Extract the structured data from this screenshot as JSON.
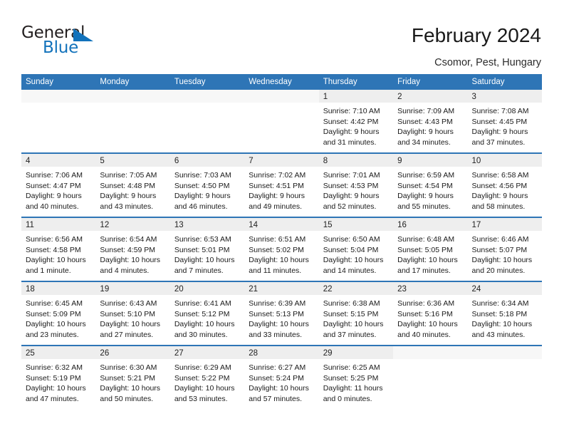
{
  "brand": {
    "word_one": "General",
    "word_two": "Blue",
    "logo_icon": "triangle-logo-icon",
    "accent_color": "#1272bb"
  },
  "header": {
    "title": "February 2024",
    "subtitle": "Csomor, Pest, Hungary"
  },
  "theme": {
    "header_blue": "#2e75b6",
    "day_band_gray": "#eeeeee",
    "text_color": "#1a1a1a"
  },
  "weekdays": [
    "Sunday",
    "Monday",
    "Tuesday",
    "Wednesday",
    "Thursday",
    "Friday",
    "Saturday"
  ],
  "weeks": [
    [
      {
        "day": "",
        "lines": []
      },
      {
        "day": "",
        "lines": []
      },
      {
        "day": "",
        "lines": []
      },
      {
        "day": "",
        "lines": []
      },
      {
        "day": "1",
        "lines": [
          "Sunrise: 7:10 AM",
          "Sunset: 4:42 PM",
          "Daylight: 9 hours",
          "and 31 minutes."
        ]
      },
      {
        "day": "2",
        "lines": [
          "Sunrise: 7:09 AM",
          "Sunset: 4:43 PM",
          "Daylight: 9 hours",
          "and 34 minutes."
        ]
      },
      {
        "day": "3",
        "lines": [
          "Sunrise: 7:08 AM",
          "Sunset: 4:45 PM",
          "Daylight: 9 hours",
          "and 37 minutes."
        ]
      }
    ],
    [
      {
        "day": "4",
        "lines": [
          "Sunrise: 7:06 AM",
          "Sunset: 4:47 PM",
          "Daylight: 9 hours",
          "and 40 minutes."
        ]
      },
      {
        "day": "5",
        "lines": [
          "Sunrise: 7:05 AM",
          "Sunset: 4:48 PM",
          "Daylight: 9 hours",
          "and 43 minutes."
        ]
      },
      {
        "day": "6",
        "lines": [
          "Sunrise: 7:03 AM",
          "Sunset: 4:50 PM",
          "Daylight: 9 hours",
          "and 46 minutes."
        ]
      },
      {
        "day": "7",
        "lines": [
          "Sunrise: 7:02 AM",
          "Sunset: 4:51 PM",
          "Daylight: 9 hours",
          "and 49 minutes."
        ]
      },
      {
        "day": "8",
        "lines": [
          "Sunrise: 7:01 AM",
          "Sunset: 4:53 PM",
          "Daylight: 9 hours",
          "and 52 minutes."
        ]
      },
      {
        "day": "9",
        "lines": [
          "Sunrise: 6:59 AM",
          "Sunset: 4:54 PM",
          "Daylight: 9 hours",
          "and 55 minutes."
        ]
      },
      {
        "day": "10",
        "lines": [
          "Sunrise: 6:58 AM",
          "Sunset: 4:56 PM",
          "Daylight: 9 hours",
          "and 58 minutes."
        ]
      }
    ],
    [
      {
        "day": "11",
        "lines": [
          "Sunrise: 6:56 AM",
          "Sunset: 4:58 PM",
          "Daylight: 10 hours",
          "and 1 minute."
        ]
      },
      {
        "day": "12",
        "lines": [
          "Sunrise: 6:54 AM",
          "Sunset: 4:59 PM",
          "Daylight: 10 hours",
          "and 4 minutes."
        ]
      },
      {
        "day": "13",
        "lines": [
          "Sunrise: 6:53 AM",
          "Sunset: 5:01 PM",
          "Daylight: 10 hours",
          "and 7 minutes."
        ]
      },
      {
        "day": "14",
        "lines": [
          "Sunrise: 6:51 AM",
          "Sunset: 5:02 PM",
          "Daylight: 10 hours",
          "and 11 minutes."
        ]
      },
      {
        "day": "15",
        "lines": [
          "Sunrise: 6:50 AM",
          "Sunset: 5:04 PM",
          "Daylight: 10 hours",
          "and 14 minutes."
        ]
      },
      {
        "day": "16",
        "lines": [
          "Sunrise: 6:48 AM",
          "Sunset: 5:05 PM",
          "Daylight: 10 hours",
          "and 17 minutes."
        ]
      },
      {
        "day": "17",
        "lines": [
          "Sunrise: 6:46 AM",
          "Sunset: 5:07 PM",
          "Daylight: 10 hours",
          "and 20 minutes."
        ]
      }
    ],
    [
      {
        "day": "18",
        "lines": [
          "Sunrise: 6:45 AM",
          "Sunset: 5:09 PM",
          "Daylight: 10 hours",
          "and 23 minutes."
        ]
      },
      {
        "day": "19",
        "lines": [
          "Sunrise: 6:43 AM",
          "Sunset: 5:10 PM",
          "Daylight: 10 hours",
          "and 27 minutes."
        ]
      },
      {
        "day": "20",
        "lines": [
          "Sunrise: 6:41 AM",
          "Sunset: 5:12 PM",
          "Daylight: 10 hours",
          "and 30 minutes."
        ]
      },
      {
        "day": "21",
        "lines": [
          "Sunrise: 6:39 AM",
          "Sunset: 5:13 PM",
          "Daylight: 10 hours",
          "and 33 minutes."
        ]
      },
      {
        "day": "22",
        "lines": [
          "Sunrise: 6:38 AM",
          "Sunset: 5:15 PM",
          "Daylight: 10 hours",
          "and 37 minutes."
        ]
      },
      {
        "day": "23",
        "lines": [
          "Sunrise: 6:36 AM",
          "Sunset: 5:16 PM",
          "Daylight: 10 hours",
          "and 40 minutes."
        ]
      },
      {
        "day": "24",
        "lines": [
          "Sunrise: 6:34 AM",
          "Sunset: 5:18 PM",
          "Daylight: 10 hours",
          "and 43 minutes."
        ]
      }
    ],
    [
      {
        "day": "25",
        "lines": [
          "Sunrise: 6:32 AM",
          "Sunset: 5:19 PM",
          "Daylight: 10 hours",
          "and 47 minutes."
        ]
      },
      {
        "day": "26",
        "lines": [
          "Sunrise: 6:30 AM",
          "Sunset: 5:21 PM",
          "Daylight: 10 hours",
          "and 50 minutes."
        ]
      },
      {
        "day": "27",
        "lines": [
          "Sunrise: 6:29 AM",
          "Sunset: 5:22 PM",
          "Daylight: 10 hours",
          "and 53 minutes."
        ]
      },
      {
        "day": "28",
        "lines": [
          "Sunrise: 6:27 AM",
          "Sunset: 5:24 PM",
          "Daylight: 10 hours",
          "and 57 minutes."
        ]
      },
      {
        "day": "29",
        "lines": [
          "Sunrise: 6:25 AM",
          "Sunset: 5:25 PM",
          "Daylight: 11 hours",
          "and 0 minutes."
        ]
      },
      {
        "day": "",
        "lines": []
      },
      {
        "day": "",
        "lines": []
      }
    ]
  ]
}
